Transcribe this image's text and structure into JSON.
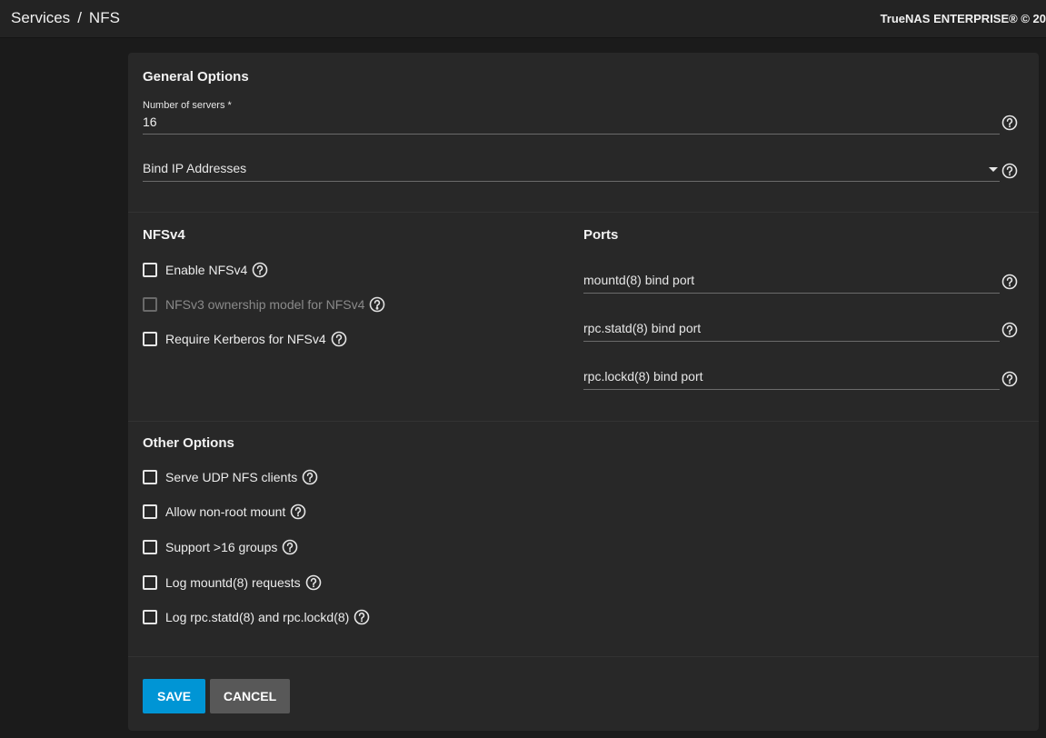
{
  "breadcrumb": {
    "parent": "Services",
    "separator": "/",
    "current": "NFS"
  },
  "brand": "TrueNAS ENTERPRISE® © 20",
  "general": {
    "title": "General Options",
    "servers_label": "Number of servers *",
    "servers_value": "16",
    "bind_ip_label": "Bind IP Addresses"
  },
  "nfsv4": {
    "title": "NFSv4",
    "enable": "Enable NFSv4",
    "ownership": "NFSv3 ownership model for NFSv4",
    "kerberos": "Require Kerberos for NFSv4"
  },
  "ports": {
    "title": "Ports",
    "mountd": "mountd(8) bind port",
    "statd": "rpc.statd(8) bind port",
    "lockd": "rpc.lockd(8) bind port"
  },
  "other": {
    "title": "Other Options",
    "udp": "Serve UDP NFS clients",
    "nonroot": "Allow non-root mount",
    "groups": "Support >16 groups",
    "log_mountd": "Log mountd(8) requests",
    "log_statd": "Log rpc.statd(8) and rpc.lockd(8)"
  },
  "actions": {
    "save": "SAVE",
    "cancel": "CANCEL"
  },
  "colors": {
    "accent": "#0095d5",
    "cancel": "#585858",
    "surface": "#282828",
    "background": "#1b1b1b"
  }
}
